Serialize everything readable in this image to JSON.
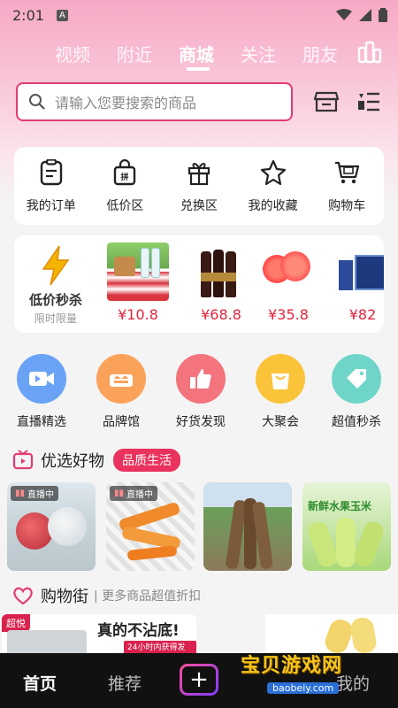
{
  "status": {
    "time": "2:01",
    "a_label": "A"
  },
  "nav": {
    "tabs": [
      "视频",
      "附近",
      "商城",
      "关注",
      "朋友"
    ],
    "active": "商城"
  },
  "search": {
    "placeholder": "请输入您要搜索的商品"
  },
  "shortcuts": [
    "我的订单",
    "低价区",
    "兑换区",
    "我的收藏",
    "购物车"
  ],
  "flash": {
    "title": "低价秒杀",
    "subtitle": "限时限量",
    "items": [
      {
        "price": "¥10.8"
      },
      {
        "price": "¥68.8"
      },
      {
        "price": "¥35.8"
      },
      {
        "price": "¥82"
      }
    ]
  },
  "categories": [
    "直播精选",
    "品牌馆",
    "好货发现",
    "大聚会",
    "超值秒杀"
  ],
  "selected": {
    "title": "优选好物",
    "badge": "品质生活",
    "live_label": "直播中"
  },
  "products": [
    {
      "live": "直播中"
    },
    {
      "live": "直播中"
    },
    {
      "live": ""
    },
    {
      "tag": "新鲜水果玉米"
    }
  ],
  "street": {
    "title": "购物街",
    "subtitle": "| 更多商品超值折扣"
  },
  "banner": {
    "hot": "超悦",
    "headline": "真的不沾底!",
    "small": "24小时内获得发货"
  },
  "tabbar": {
    "home": "首页",
    "recommend": "推荐",
    "plus": "+",
    "mine": "我的"
  },
  "watermark": {
    "title": "宝贝游戏网",
    "url": "baobeiy.com"
  },
  "colors": {
    "accent": "#e23a74",
    "price": "#e4243b",
    "badge": "#e9325d"
  }
}
